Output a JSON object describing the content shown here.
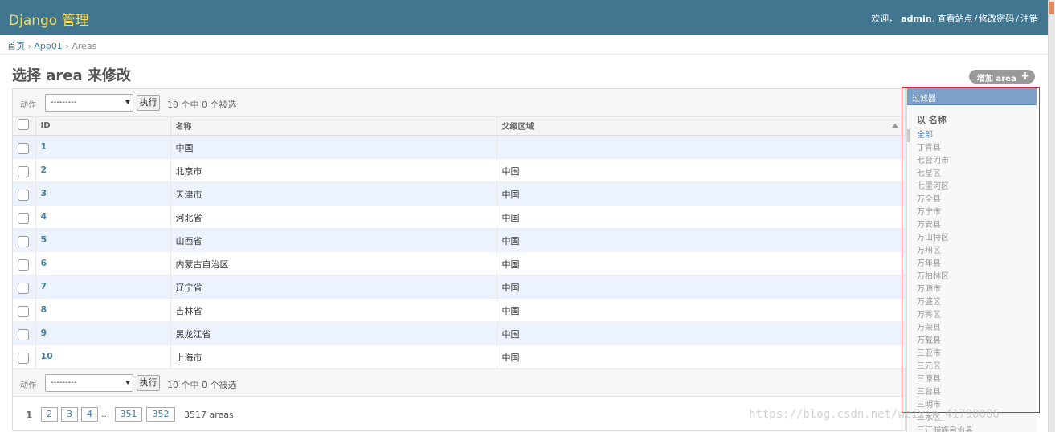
{
  "header": {
    "brand": "Django 管理",
    "welcome": "欢迎，",
    "username": "admin",
    "links": [
      "查看站点",
      "修改密码",
      "注销"
    ],
    "sep": "/"
  },
  "breadcrumbs": {
    "items": [
      "首页",
      "App01",
      "Areas"
    ],
    "sep": "›"
  },
  "page_title": "选择 area 来修改",
  "add_button": {
    "label": "增加 area",
    "icon": "+"
  },
  "actions": {
    "label": "动作",
    "select_value": "---------",
    "go_label": "执行",
    "counter": "10 个中 0 个被选"
  },
  "table": {
    "columns": [
      "ID",
      "名称",
      "父级区域"
    ],
    "rows": [
      {
        "id": "1",
        "name": "中国",
        "parent": ""
      },
      {
        "id": "2",
        "name": "北京市",
        "parent": "中国"
      },
      {
        "id": "3",
        "name": "天津市",
        "parent": "中国"
      },
      {
        "id": "4",
        "name": "河北省",
        "parent": "中国"
      },
      {
        "id": "5",
        "name": "山西省",
        "parent": "中国"
      },
      {
        "id": "6",
        "name": "内蒙古自治区",
        "parent": "中国"
      },
      {
        "id": "7",
        "name": "辽宁省",
        "parent": "中国"
      },
      {
        "id": "8",
        "name": "吉林省",
        "parent": "中国"
      },
      {
        "id": "9",
        "name": "黑龙江省",
        "parent": "中国"
      },
      {
        "id": "10",
        "name": "上海市",
        "parent": "中国"
      }
    ]
  },
  "paginator": {
    "current": "1",
    "pages": [
      "2",
      "3",
      "4",
      "351",
      "352"
    ],
    "ellipsis": "...",
    "total": "3517 areas"
  },
  "filter": {
    "title": "过滤器",
    "section": "以 名称",
    "items": [
      "全部",
      "丁青县",
      "七台河市",
      "七星区",
      "七里河区",
      "万全县",
      "万宁市",
      "万安县",
      "万山特区",
      "万州区",
      "万年县",
      "万柏林区",
      "万源市",
      "万盛区",
      "万秀区",
      "万荣县",
      "万载县",
      "三亚市",
      "三元区",
      "三原县",
      "三台县",
      "三明市",
      "三水区",
      "三江侗族自治县"
    ]
  },
  "watermark": "https://blog.csdn.net/weixin_41790086",
  "colors": {
    "header_bg": "#417690",
    "brand": "#f5dd5d",
    "link": "#447e9b",
    "filter_header": "#7ca0c7",
    "highlight_box": "#e0262f"
  }
}
